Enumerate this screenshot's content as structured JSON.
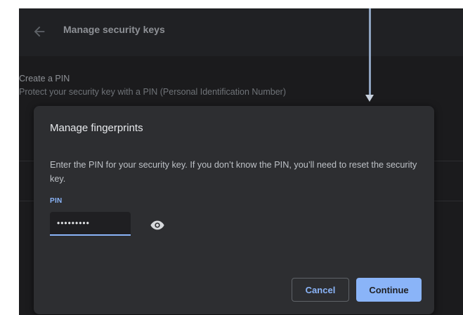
{
  "header": {
    "title": "Manage security keys",
    "back_icon": "arrow-back-icon"
  },
  "section": {
    "title": "Create a PIN",
    "description": "Protect your security key with a PIN (Personal Identification Number)"
  },
  "dialog": {
    "title": "Manage fingerprints",
    "body": "Enter the PIN for your security key. If you don’t know the PIN, you’ll need to reset the security key.",
    "pin_label": "PIN",
    "pin_value": "•••••••••",
    "eye_icon": "visibility-icon",
    "cancel_label": "Cancel",
    "continue_label": "Continue"
  },
  "colors": {
    "accent": "#8ab4f8",
    "dialog_bg": "#2d2e31",
    "page_bg": "#1b1b1d",
    "annotation_arrow": "#8ea3c0"
  }
}
